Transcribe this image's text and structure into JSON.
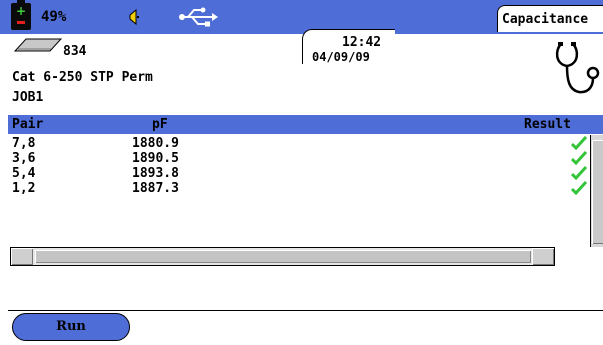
{
  "status": {
    "battery_percent": "49%",
    "title": "Capacitance",
    "count": "834",
    "time": "12:42",
    "date": "04/09/09",
    "icons": [
      "battery-icon",
      "speaker-icon",
      "usb-icon",
      "disk-icon",
      "stethoscope-icon"
    ]
  },
  "info": {
    "cable": "Cat 6-250 STP Perm",
    "job": "JOB1"
  },
  "table": {
    "headers": {
      "pair": "Pair",
      "pf": "pF",
      "result": "Result"
    },
    "rows": [
      {
        "pair": "7,8",
        "pf": "1880.9"
      },
      {
        "pair": "3,6",
        "pf": "1890.5"
      },
      {
        "pair": "5,4",
        "pf": "1893.8"
      },
      {
        "pair": "1,2",
        "pf": "1887.3"
      }
    ]
  },
  "actions": {
    "run_label": "Run"
  },
  "colors": {
    "accent": "#4f6dd6",
    "pass": "#33c43a"
  }
}
